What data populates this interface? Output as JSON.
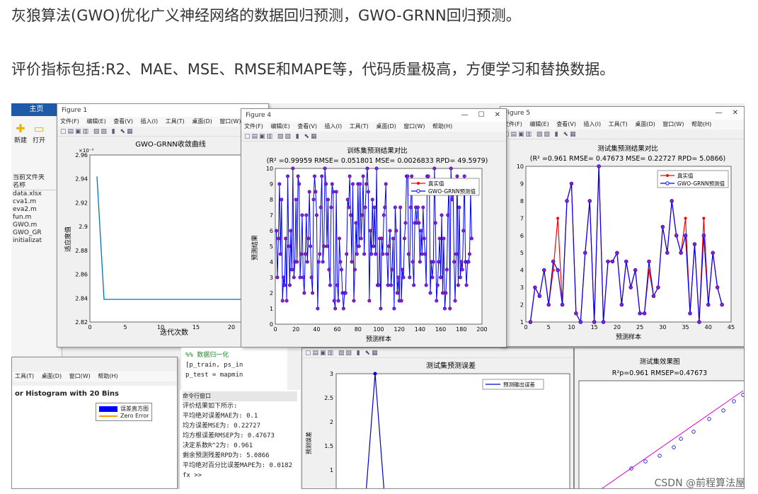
{
  "headings": {
    "line1": "灰狼算法(GWO)优化广义神经网络的数据回归预测，GWO-GRNN回归预测。",
    "line2": "评价指标包括:R2、MAE、MSE、RMSE和MAPE等，代码质量极高，方便学习和替换数据。"
  },
  "matlab_main": {
    "ribbon_tab": "主页",
    "new_label": "新建",
    "open_label": "打开",
    "current_folder": "当前文件夹",
    "name_col": "名称",
    "files": [
      "data.xlsx",
      "cva1.m",
      "eva2.m",
      "fun.m",
      "GWO.m",
      "GWO_GR",
      "initializat"
    ]
  },
  "fig1": {
    "title": "Figure 1",
    "menu": [
      "文件(F)",
      "编辑(E)",
      "查看(V)",
      "插入(I)",
      "工具(T)",
      "桌面(D)",
      "窗口(W)"
    ],
    "plot_title": "GWO-GRNN收敛曲线",
    "xlabel": "迭代次数",
    "ylabel": "适应度值",
    "exponent": "×10⁻³",
    "yticks": [
      "2.96",
      "2.94",
      "2.92",
      "2.9",
      "2.88",
      "2.86",
      "2.84",
      "2.82"
    ],
    "xticks": [
      "0",
      "5",
      "10",
      "15",
      "20"
    ]
  },
  "fig4": {
    "title": "Figure 4",
    "menu": [
      "文件(F)",
      "编辑(E)",
      "查看(V)",
      "插入(I)",
      "工具(T)",
      "桌面(D)",
      "窗口(W)",
      "帮助(H)"
    ],
    "plot_title": "训练集预测结果对比",
    "subtitle": "(R² =0.99959 RMSE= 0.051801 MSE= 0.0026833 RPD= 49.5979)",
    "xlabel": "预测样本",
    "ylabel": "预测结果",
    "legend": [
      "真实值",
      "GWO-GRNN预测值"
    ],
    "yticks": [
      "10",
      "9",
      "8",
      "7",
      "6",
      "5",
      "4",
      "3",
      "2",
      "1",
      "0"
    ],
    "xticks": [
      "0",
      "20",
      "40",
      "60",
      "80",
      "100",
      "120",
      "140",
      "160",
      "180",
      "200"
    ]
  },
  "fig5": {
    "title": "Figure 5",
    "menu": [
      "文件(F)",
      "编辑(E)",
      "查看(V)",
      "插入(I)",
      "工具(T)",
      "桌面(D)",
      "窗口(W)",
      "帮助(H)"
    ],
    "plot_title": "测试集预测结果对比",
    "subtitle": "(R² =0.961 RMSE= 0.47673 MSE= 0.22727 RPD= 5.0866)",
    "xlabel": "预测样本",
    "ylabel": "预测结果",
    "legend": [
      "真实值",
      "GWO-GRNN预测值"
    ],
    "yticks": [
      "10",
      "9",
      "8",
      "7",
      "6",
      "5",
      "4",
      "3",
      "2",
      "1"
    ],
    "xticks": [
      "0",
      "5",
      "10",
      "15",
      "20",
      "25",
      "30",
      "35",
      "40",
      "45"
    ]
  },
  "fig_hist": {
    "menu": [
      "工具(T)",
      "桌面(D)",
      "窗口(W)",
      "帮助(H)"
    ],
    "plot_title": "or Histogram with 20 Bins",
    "legend": [
      "误差直方图",
      "Zero Error"
    ]
  },
  "editor": {
    "line1": "%%  数据归一化",
    "line2": "[p_train, ps_in",
    "line3": "p_test = mapmin"
  },
  "command": {
    "title": "命令行窗口",
    "lines": [
      "评价结果如下所示:",
      "平均绝对误差MAE为:  0.1",
      "均方误差MSE为:        0.22727",
      "均方根误差RMSEP为:   0.47673",
      "决定系数R^2为:   0.961",
      "剩余预测残差RPD为:   5.0866",
      "平均绝对百分比误差MAPE为:   0.0182"
    ],
    "prompt": "fx >>"
  },
  "fig_err": {
    "plot_title": "测试集预测误差",
    "legend": [
      "预测输出误差"
    ],
    "ylabel": "预测误差",
    "yticks": [
      "3",
      "2.5",
      "2",
      "1.5",
      "1",
      "0.5"
    ]
  },
  "fig_eff": {
    "plot_title": "测试集效果图",
    "subtitle": "R²p=0.961  RMSEP=0.47673"
  },
  "watermark": "CSDN @前程算法屋",
  "chart_data": [
    {
      "type": "line",
      "title": "GWO-GRNN收敛曲线",
      "xlabel": "迭代次数",
      "ylabel": "适应度值",
      "x": [
        1,
        2,
        3,
        5,
        10,
        15,
        20,
        25
      ],
      "values": [
        0.002942,
        0.002839,
        0.002839,
        0.002839,
        0.002839,
        0.002839,
        0.002839,
        0.002839
      ],
      "ylim": [
        0.00282,
        0.00296
      ],
      "xlim": [
        0,
        25
      ]
    },
    {
      "type": "line",
      "title": "测试集预测结果对比",
      "xlabel": "预测样本",
      "ylabel": "预测结果",
      "x": [
        1,
        2,
        3,
        4,
        5,
        6,
        7,
        8,
        9,
        10,
        11,
        12,
        13,
        14,
        15,
        16,
        17,
        18,
        19,
        20,
        21,
        22,
        23,
        24,
        25,
        26,
        27,
        28,
        29,
        30,
        31,
        32,
        33,
        34,
        35,
        36,
        37,
        38,
        39,
        40,
        41,
        42,
        43,
        44
      ],
      "series": [
        {
          "name": "真实值",
          "values": [
            1,
            3,
            2.5,
            4,
            2,
            4,
            7,
            2,
            8,
            9,
            1.5,
            1,
            5,
            8,
            1,
            10,
            1,
            4.5,
            4.5,
            5,
            2,
            4.5,
            3,
            4,
            1.5,
            1.5,
            4,
            2.5,
            3,
            6.5,
            5,
            8,
            6,
            5,
            7,
            1.5,
            5.5,
            1,
            7,
            2,
            5,
            3,
            2
          ]
        },
        {
          "name": "GWO-GRNN预测值",
          "values": [
            1,
            3,
            2.5,
            4,
            2,
            4.5,
            4,
            2,
            8,
            9,
            1.5,
            1,
            5,
            8,
            1,
            10,
            1,
            4.5,
            4.5,
            5,
            2,
            4.5,
            3,
            4,
            1.5,
            1.5,
            4.5,
            2.5,
            3,
            6.5,
            5,
            8,
            6,
            5,
            6,
            1.5,
            5.5,
            1,
            6,
            2,
            5,
            3,
            2
          ]
        }
      ],
      "ylim": [
        1,
        10
      ],
      "xlim": [
        0,
        45
      ]
    },
    {
      "type": "line",
      "title": "测试集预测误差",
      "ylabel": "预测误差",
      "series": [
        {
          "name": "预测输出误差",
          "values": [
            0,
            3,
            0
          ]
        }
      ],
      "ylim": [
        0,
        3
      ]
    }
  ]
}
